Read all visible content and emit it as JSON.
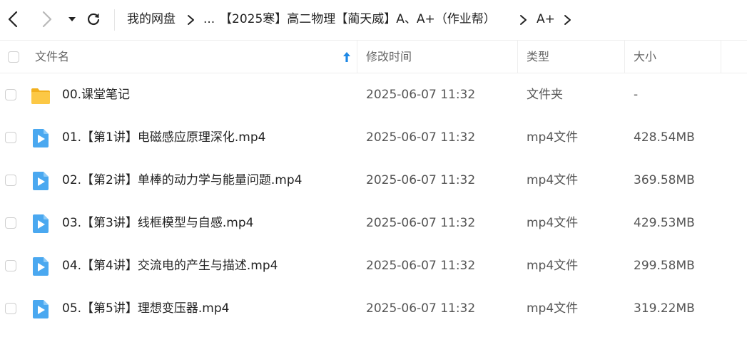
{
  "toolbar": {
    "back_icon": "chevron-left-icon",
    "forward_icon": "chevron-right-icon",
    "dropdown_icon": "caret-down-icon",
    "refresh_icon": "refresh-icon",
    "breadcrumb": [
      "我的网盘",
      "...",
      "【2025寒】高二物理【蔺天威】A、A+（作业帮）",
      "A+"
    ]
  },
  "table": {
    "columns": {
      "name": "文件名",
      "modified": "修改时间",
      "type": "类型",
      "size": "大小"
    },
    "sort_icon": "sort-up-arrow-icon",
    "rows": [
      {
        "name": "00.课堂笔记",
        "modified": "2025-06-07 11:32",
        "type": "文件夹",
        "size": "-",
        "icon": "folder-icon"
      },
      {
        "name": "01.【第1讲】电磁感应原理深化.mp4",
        "modified": "2025-06-07 11:32",
        "type": "mp4文件",
        "size": "428.54MB",
        "icon": "video-file-icon"
      },
      {
        "name": "02.【第2讲】单棒的动力学与能量问题.mp4",
        "modified": "2025-06-07 11:32",
        "type": "mp4文件",
        "size": "369.58MB",
        "icon": "video-file-icon"
      },
      {
        "name": "03.【第3讲】线框模型与自感.mp4",
        "modified": "2025-06-07 11:32",
        "type": "mp4文件",
        "size": "429.53MB",
        "icon": "video-file-icon"
      },
      {
        "name": "04.【第4讲】交流电的产生与描述.mp4",
        "modified": "2025-06-07 11:32",
        "type": "mp4文件",
        "size": "299.58MB",
        "icon": "video-file-icon"
      },
      {
        "name": "05.【第5讲】理想变压器.mp4",
        "modified": "2025-06-07 11:32",
        "type": "mp4文件",
        "size": "319.22MB",
        "icon": "video-file-icon"
      }
    ]
  },
  "colors": {
    "accent": "#1e88e5",
    "folder": "#f7c23b",
    "video": "#4aa8f0"
  }
}
